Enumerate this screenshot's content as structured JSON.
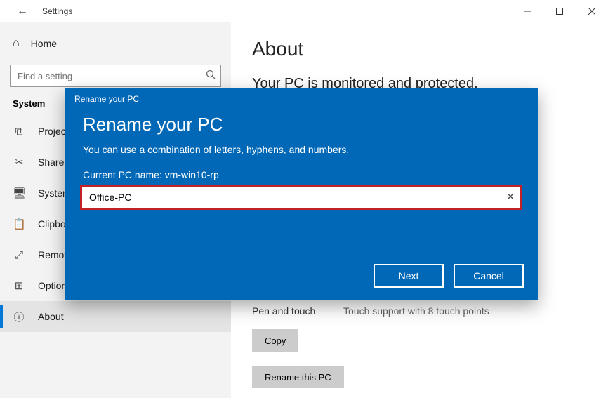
{
  "window": {
    "title": "Settings"
  },
  "sidebar": {
    "home": "Home",
    "search_placeholder": "Find a setting",
    "heading": "System",
    "items": [
      {
        "icon": "projecting-icon",
        "glyph": "⧉",
        "label": "Projecting to this PC"
      },
      {
        "icon": "scissors-icon",
        "glyph": "✂",
        "label": "Shared experiences"
      },
      {
        "icon": "monitor-icon",
        "glyph": "🖥",
        "label": "System components"
      },
      {
        "icon": "clipboard-icon",
        "glyph": "📋",
        "label": "Clipboard"
      },
      {
        "icon": "remote-icon",
        "glyph": "⤢",
        "label": "Remote Desktop"
      },
      {
        "icon": "features-icon",
        "glyph": "⊞",
        "label": "Optional features"
      },
      {
        "icon": "info-icon",
        "glyph": "ⓘ",
        "label": "About",
        "selected": true
      }
    ]
  },
  "content": {
    "title": "About",
    "subtitle": "Your PC is monitored and protected.",
    "pen_label": "Pen and touch",
    "pen_value": "Touch support with 8 touch points",
    "copy_btn": "Copy",
    "rename_btn": "Rename this PC"
  },
  "dialog": {
    "small_title": "Rename your PC",
    "heading": "Rename your PC",
    "hint": "You can use a combination of letters, hyphens, and numbers.",
    "current_label": "Current PC name:",
    "current_value": "vm-win10-rp",
    "input_value": "Office-PC",
    "next": "Next",
    "cancel": "Cancel"
  }
}
